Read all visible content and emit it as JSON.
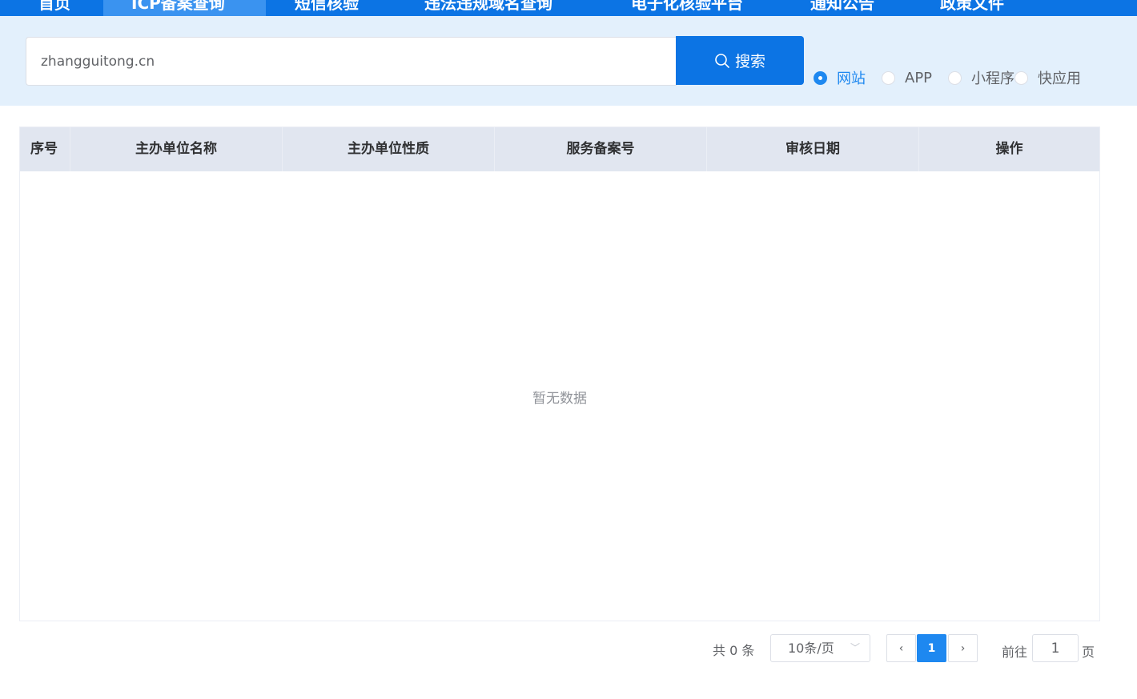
{
  "nav": {
    "items": [
      "首页",
      "ICP备案查询",
      "短信核验",
      "违法违规域名查询",
      "电子化核验平台",
      "通知公告",
      "政策文件"
    ]
  },
  "search": {
    "value": "zhangguitong.cn",
    "button_label": "搜索",
    "types": [
      "网站",
      "APP",
      "小程序",
      "快应用"
    ],
    "selected": "网站"
  },
  "table": {
    "columns": [
      "序号",
      "主办单位名称",
      "主办单位性质",
      "服务备案号",
      "审核日期",
      "操作"
    ],
    "rows": [],
    "empty_text": "暂无数据"
  },
  "pagination": {
    "total_text": "共 0 条",
    "page_size": "10条/页",
    "current_page": "1",
    "goto_label": "前往",
    "goto_value": "1",
    "goto_suffix": "页"
  },
  "colors": {
    "primary": "#0c74e4",
    "accent": "#1e88f0",
    "band": "#e3f0fc",
    "table_header": "#e1e6f0"
  }
}
